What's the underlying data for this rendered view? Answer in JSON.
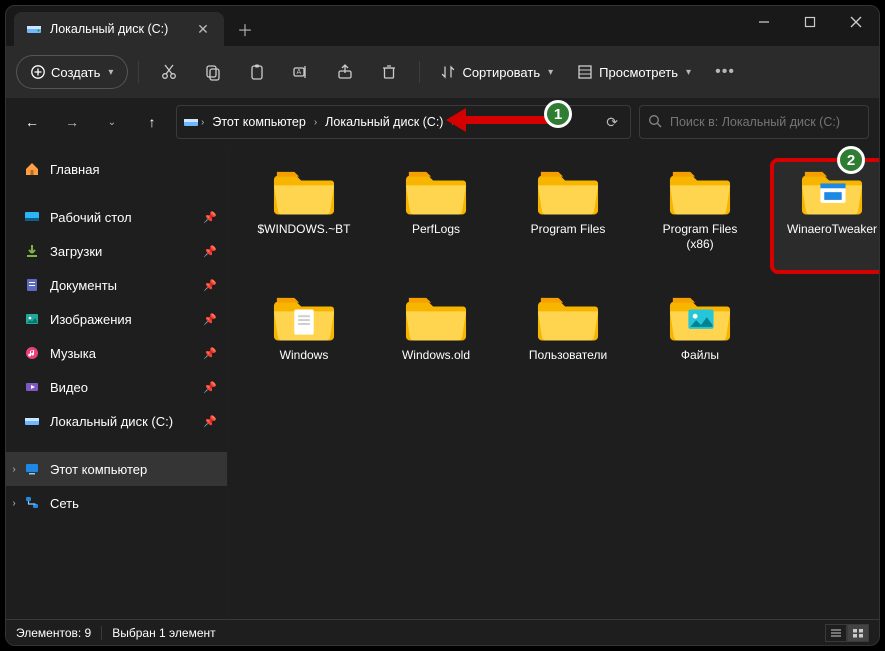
{
  "tab": {
    "title": "Локальный диск (C:)"
  },
  "toolbar": {
    "create": "Создать",
    "sort": "Сортировать",
    "view": "Просмотреть"
  },
  "breadcrumbs": [
    "Этот компьютер",
    "Локальный диск (C:)"
  ],
  "search": {
    "placeholder": "Поиск в: Локальный диск (C:)"
  },
  "sidebar": {
    "home": "Главная",
    "quick": [
      {
        "label": "Рабочий стол"
      },
      {
        "label": "Загрузки"
      },
      {
        "label": "Документы"
      },
      {
        "label": "Изображения"
      },
      {
        "label": "Музыка"
      },
      {
        "label": "Видео"
      },
      {
        "label": "Локальный диск (C:)"
      }
    ],
    "thispc": "Этот компьютер",
    "network": "Сеть"
  },
  "folders": [
    {
      "label": "$WINDOWS.~BT",
      "variant": "plain"
    },
    {
      "label": "PerfLogs",
      "variant": "plain"
    },
    {
      "label": "Program Files",
      "variant": "plain"
    },
    {
      "label": "Program Files\n(x86)",
      "variant": "plain"
    },
    {
      "label": "WinaeroTweaker",
      "variant": "app",
      "selected": true
    },
    {
      "label": "Windows",
      "variant": "doc"
    },
    {
      "label": "Windows.old",
      "variant": "plain"
    },
    {
      "label": "Пользователи",
      "variant": "plain"
    },
    {
      "label": "Файлы",
      "variant": "pic"
    }
  ],
  "status": {
    "count": "Элементов: 9",
    "selection": "Выбран 1 элемент"
  },
  "annotations": {
    "badge1": "1",
    "badge2": "2"
  }
}
